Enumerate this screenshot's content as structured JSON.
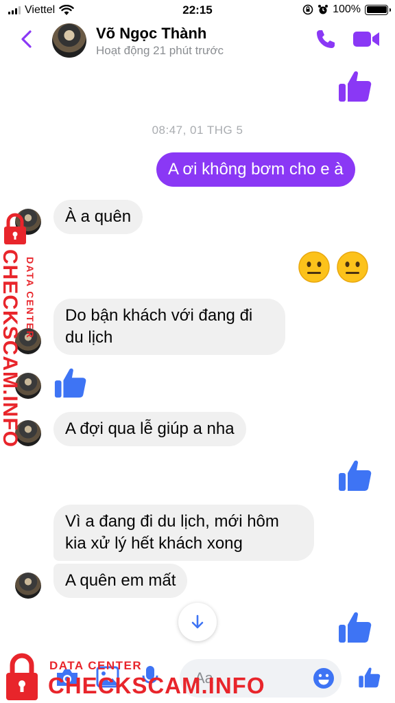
{
  "status_bar": {
    "carrier": "Viettel",
    "time": "22:15",
    "battery": "100%"
  },
  "header": {
    "name": "Võ Ngọc Thành",
    "status": "Hoạt động 21 phút trước"
  },
  "conversation": {
    "timestamp": "08:47, 01 THG 5",
    "messages": [
      {
        "side": "out",
        "type": "text",
        "text": "A ơi không bơm cho e à"
      },
      {
        "side": "in",
        "type": "text",
        "text": "À a quên"
      },
      {
        "side": "out",
        "type": "emoji",
        "emoji": "neutral-face"
      },
      {
        "side": "in",
        "type": "text",
        "text": "Do bận khách với đang đi du lịch"
      },
      {
        "side": "in",
        "type": "like"
      },
      {
        "side": "in",
        "type": "text",
        "text": "A đợi qua lễ giúp a nha"
      },
      {
        "side": "out",
        "type": "like"
      },
      {
        "side": "in",
        "type": "text",
        "text": "Vì a đang đi du lịch, mới hôm kia xử lý hết khách xong"
      },
      {
        "side": "in",
        "type": "text",
        "text": "A quên em mất"
      },
      {
        "side": "out",
        "type": "like"
      }
    ]
  },
  "composer": {
    "placeholder": "Aa"
  },
  "watermark": {
    "brand": "CHECKSCAM.INFO",
    "subtitle": "DATA CENTER"
  },
  "colors": {
    "accent": "#8a38f5",
    "like_blue": "#3e74f4",
    "watermark_red": "#e8252b"
  },
  "icons": [
    "back-chevron-icon",
    "phone-icon",
    "video-camera-icon",
    "thumbs-up-icon",
    "neutral-face-emoji",
    "arrow-down-icon",
    "camera-icon",
    "image-icon",
    "microphone-icon",
    "emoji-icon"
  ]
}
